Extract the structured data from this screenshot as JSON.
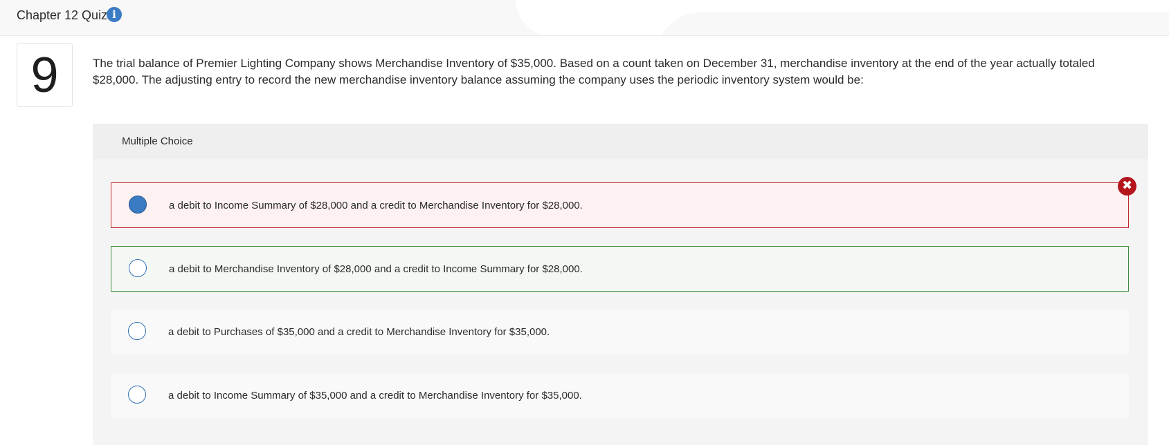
{
  "header": {
    "title": "Chapter 12 Quiz",
    "info_icon": "info-icon"
  },
  "question": {
    "number": "9",
    "prompt": "The trial balance of Premier Lighting Company shows Merchandise Inventory of $35,000. Based on a count taken on December 31, merchandise inventory at the end of the year actually totaled $28,000. The adjusting entry to record the new merchandise inventory balance assuming the company uses the periodic inventory system would be:"
  },
  "multiple_choice": {
    "label": "Multiple Choice",
    "choices": [
      {
        "text": "a debit to Income Summary of $28,000 and a credit to Merchandise Inventory for $28,000.",
        "selected": true,
        "status": "incorrect"
      },
      {
        "text": "a debit to Merchandise Inventory of $28,000 and a credit to Income Summary for $28,000.",
        "selected": false,
        "status": "correct"
      },
      {
        "text": "a debit to Purchases of $35,000 and a credit to Merchandise Inventory for $35,000.",
        "selected": false,
        "status": "none"
      },
      {
        "text": "a debit to Income Summary of $35,000 and a credit to Merchandise Inventory for $35,000.",
        "selected": false,
        "status": "none"
      }
    ],
    "incorrect_icon": "close-icon"
  },
  "colors": {
    "accent": "#3b7bc4",
    "incorrect": "#c0282d",
    "correct": "#3d8b3d"
  }
}
